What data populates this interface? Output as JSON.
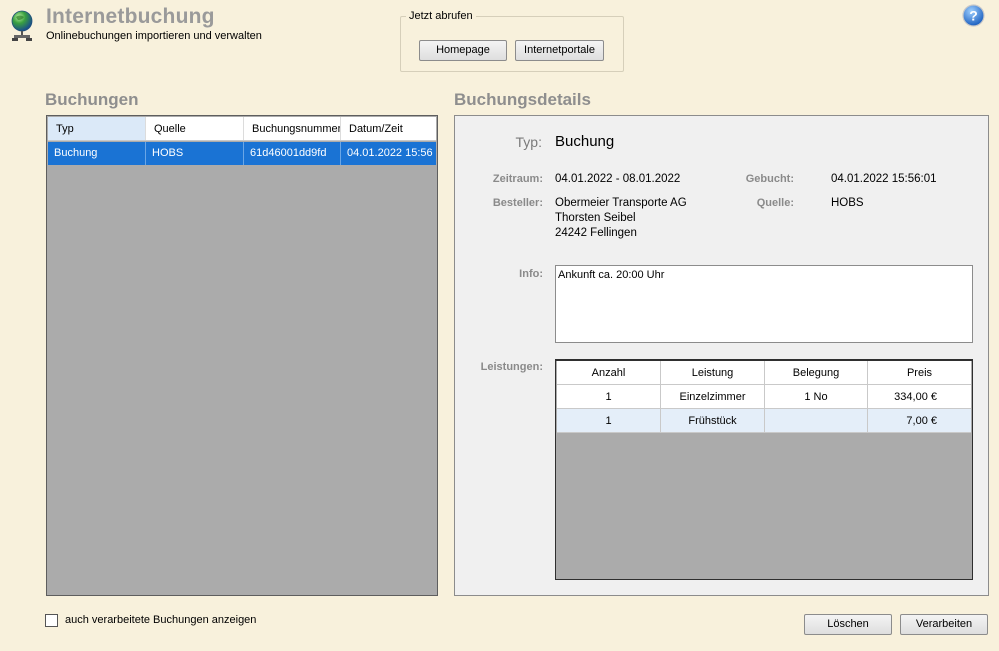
{
  "header": {
    "title": "Internetbuchung",
    "subtitle": "Onlinebuchungen importieren und verwalten",
    "app_icon": "globe-network-icon",
    "help_icon": "help-question-icon"
  },
  "fetch_group": {
    "legend": "Jetzt abrufen",
    "homepage_label": "Homepage",
    "portale_label": "Internetportale"
  },
  "bookings": {
    "title": "Buchungen",
    "columns": [
      "Typ",
      "Quelle",
      "Buchungsnummer",
      "Datum/Zeit"
    ],
    "rows": [
      {
        "typ": "Buchung",
        "quelle": "HOBS",
        "nummer": "61d46001dd9fd",
        "datum": "04.01.2022 15:56"
      }
    ],
    "selected_color": "#1a73d4"
  },
  "details": {
    "title": "Buchungsdetails",
    "typ_label": "Typ:",
    "typ_value": "Buchung",
    "zeitraum_label": "Zeitraum:",
    "zeitraum_value": "04.01.2022 - 08.01.2022",
    "gebucht_label": "Gebucht:",
    "gebucht_value": "04.01.2022 15:56:01",
    "besteller_label": "Besteller:",
    "besteller_lines": [
      "Obermeier Transporte AG",
      "Thorsten Seibel",
      "24242 Fellingen"
    ],
    "quelle_label": "Quelle:",
    "quelle_value": "HOBS",
    "info_label": "Info:",
    "info_value": "Ankunft ca. 20:00 Uhr",
    "leistungen_label": "Leistungen:",
    "leistungen_columns": [
      "Anzahl",
      "Leistung",
      "Belegung",
      "Preis"
    ],
    "leistungen_rows": [
      {
        "anzahl": "1",
        "leistung": "Einzelzimmer",
        "belegung": "1 No",
        "preis": "334,00 €"
      },
      {
        "anzahl": "1",
        "leistung": "Frühstück",
        "belegung": "",
        "preis": "7,00 €"
      }
    ]
  },
  "footer": {
    "checkbox_label": "auch verarbeitete Buchungen anzeigen",
    "checkbox_checked": false,
    "delete_label": "Löschen",
    "process_label": "Verarbeiten"
  }
}
